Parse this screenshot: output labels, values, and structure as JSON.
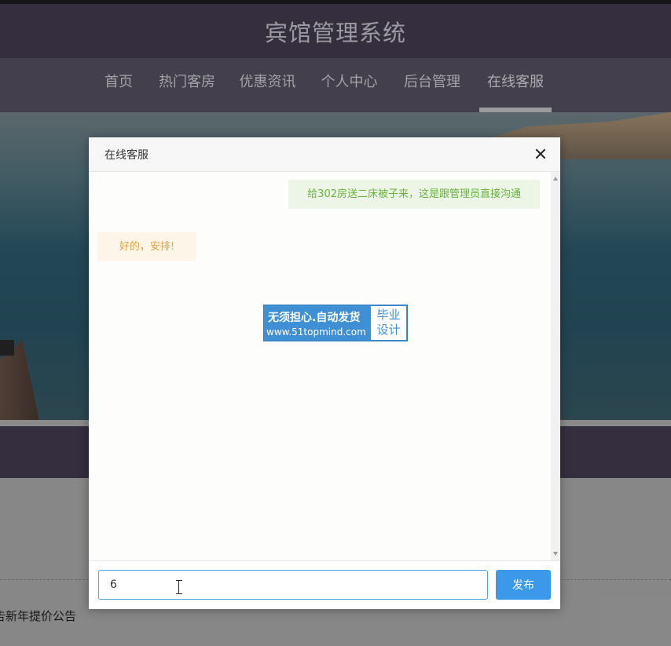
{
  "header": {
    "title": "宾馆管理系统"
  },
  "nav": {
    "items": [
      {
        "label": "首页"
      },
      {
        "label": "热门客房"
      },
      {
        "label": "优惠资讯"
      },
      {
        "label": "个人中心"
      },
      {
        "label": "后台管理"
      },
      {
        "label": "在线客服"
      }
    ],
    "active": "在线客服"
  },
  "footer": {
    "notice": "告新年提价公告"
  },
  "dialog": {
    "title": "在线客服",
    "messages": [
      {
        "side": "outgoing",
        "text": "给302房送二床被子来，这是跟管理员直接沟通"
      },
      {
        "side": "incoming",
        "text": "好的，安排!"
      }
    ],
    "watermark": {
      "line1": "无须担心.自动发货",
      "line2": "www.51topmind.com",
      "badge": "毕业\n设计"
    },
    "input": {
      "value": "6",
      "placeholder": ""
    },
    "send_label": "发布"
  },
  "colors": {
    "header_bg": "#473e53",
    "nav_bg": "#5b5566",
    "outgoing_bubble": "#edf6e6",
    "outgoing_text": "#67b33d",
    "incoming_bubble": "#fdf5e7",
    "incoming_text": "#e2a344",
    "send_button": "#3c98e8"
  }
}
